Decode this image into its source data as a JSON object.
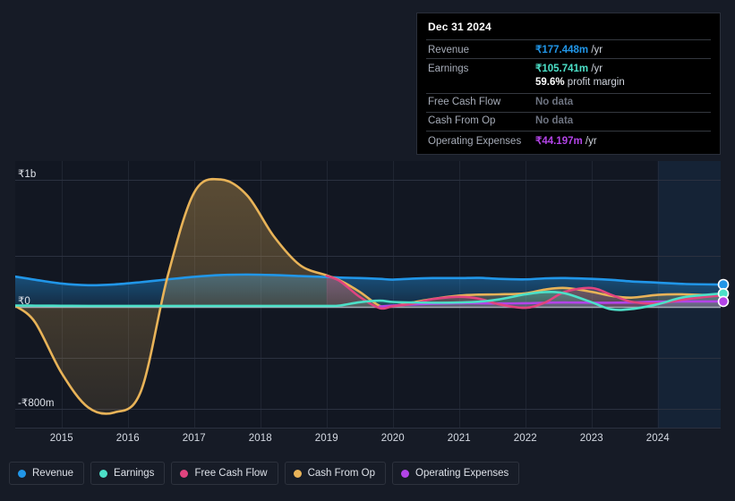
{
  "theme": {
    "background": "#161b26",
    "plot_background": "#121722",
    "grid_color": "#2b3140",
    "zero_axis_color": "#b9bfcb",
    "highlight_band": "#16263a"
  },
  "tooltip": {
    "date": "Dec 31 2024",
    "rows": [
      {
        "label": "Revenue",
        "value": "₹177.448m",
        "unit": "/yr",
        "color": "#2196e8",
        "no_data": false
      },
      {
        "label": "Earnings",
        "value": "₹105.741m",
        "unit": "/yr",
        "color": "#4ce0c8",
        "no_data": false
      },
      {
        "label": "",
        "value": "59.6%",
        "unit": "profit margin",
        "color": "#ffffff",
        "no_data": false,
        "sub": true
      },
      {
        "label": "Free Cash Flow",
        "value": "No data",
        "unit": "",
        "color": "#6d7380",
        "no_data": true
      },
      {
        "label": "Cash From Op",
        "value": "No data",
        "unit": "",
        "color": "#6d7380",
        "no_data": true
      },
      {
        "label": "Operating Expenses",
        "value": "₹44.197m",
        "unit": "/yr",
        "color": "#b344e8",
        "no_data": false
      }
    ]
  },
  "legend": {
    "items": [
      {
        "label": "Revenue",
        "color": "#2196e8"
      },
      {
        "label": "Earnings",
        "color": "#4ce0c8"
      },
      {
        "label": "Free Cash Flow",
        "color": "#e0447f"
      },
      {
        "label": "Cash From Op",
        "color": "#e8b358"
      },
      {
        "label": "Operating Expenses",
        "color": "#b344e8"
      }
    ]
  },
  "chart_data": {
    "type": "area",
    "title": "",
    "xlabel": "",
    "ylabel": "",
    "currency": "₹",
    "grid": true,
    "legend_position": "bottom",
    "x_tick_labels": [
      "2015",
      "2016",
      "2017",
      "2018",
      "2019",
      "2020",
      "2021",
      "2022",
      "2023",
      "2024"
    ],
    "y_tick_labels": [
      "₹1b",
      "₹0",
      "-₹800m"
    ],
    "y_tick_values": [
      1000,
      0,
      -800
    ],
    "ylim": [
      -950,
      1150
    ],
    "xlim": [
      2014.3,
      2024.95
    ],
    "units": "millions",
    "highlight_band_x": [
      2024.0,
      2024.95
    ],
    "endpoint_markers": [
      {
        "series": "Revenue",
        "value": 177.448,
        "color": "#2196e8"
      },
      {
        "series": "Earnings",
        "value": 105.741,
        "color": "#4ce0c8"
      },
      {
        "series": "Operating Expenses",
        "value": 44.197,
        "color": "#b344e8"
      }
    ],
    "x": [
      2014.3,
      2014.6,
      2015.0,
      2015.4,
      2015.8,
      2016.2,
      2016.6,
      2017.0,
      2017.4,
      2017.8,
      2018.2,
      2018.6,
      2019.0,
      2019.2,
      2019.5,
      2019.8,
      2020.0,
      2020.3,
      2020.6,
      2021.0,
      2021.3,
      2021.6,
      2022.0,
      2022.3,
      2022.6,
      2023.0,
      2023.3,
      2023.6,
      2024.0,
      2024.4,
      2024.95
    ],
    "series": [
      {
        "name": "Revenue",
        "color": "#2196e8",
        "fill": true,
        "values": [
          240,
          215,
          185,
          172,
          178,
          196,
          218,
          238,
          252,
          256,
          252,
          244,
          236,
          232,
          228,
          222,
          216,
          224,
          228,
          228,
          230,
          222,
          218,
          226,
          228,
          222,
          214,
          202,
          192,
          182,
          177
        ]
      },
      {
        "name": "Earnings",
        "color": "#4ce0c8",
        "fill": true,
        "values": [
          12,
          11,
          10,
          9,
          9,
          9,
          9,
          9,
          9,
          9,
          9,
          9,
          9,
          12,
          38,
          50,
          40,
          36,
          34,
          36,
          42,
          60,
          100,
          118,
          108,
          38,
          -18,
          -16,
          22,
          78,
          106
        ]
      },
      {
        "name": "Free Cash Flow",
        "color": "#e0447f",
        "fill": true,
        "values": [
          null,
          null,
          null,
          null,
          null,
          null,
          null,
          null,
          null,
          null,
          null,
          null,
          245,
          205,
          80,
          -8,
          6,
          26,
          62,
          80,
          66,
          22,
          -6,
          36,
          120,
          150,
          96,
          42,
          28,
          60,
          92
        ]
      },
      {
        "name": "Cash From Op",
        "color": "#e8b358",
        "fill": true,
        "values": [
          10,
          -120,
          -520,
          -790,
          -830,
          -660,
          240,
          900,
          1005,
          880,
          560,
          330,
          250,
          210,
          120,
          10,
          8,
          36,
          64,
          90,
          98,
          100,
          108,
          138,
          150,
          120,
          88,
          74,
          96,
          100,
          90
        ]
      },
      {
        "name": "Operating Expenses",
        "color": "#b344e8",
        "fill": true,
        "values": [
          null,
          null,
          null,
          null,
          null,
          null,
          null,
          null,
          null,
          null,
          null,
          null,
          null,
          null,
          null,
          4,
          12,
          20,
          26,
          30,
          30,
          28,
          30,
          34,
          36,
          34,
          34,
          36,
          42,
          44,
          44
        ]
      }
    ]
  }
}
